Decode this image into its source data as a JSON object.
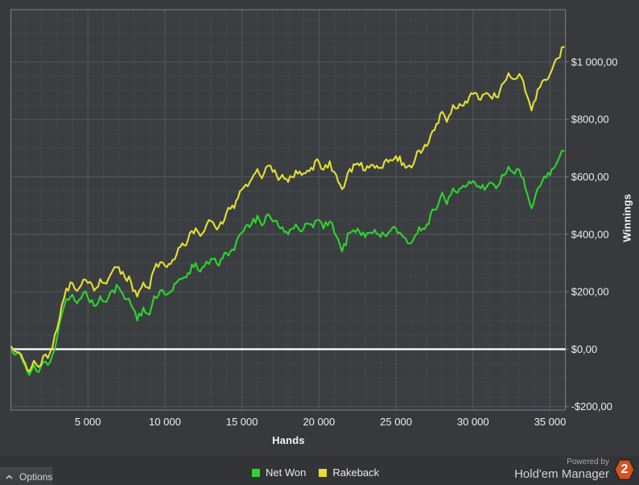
{
  "chart": {
    "x_axis": {
      "title": "Hands"
    },
    "y_axis": {
      "title": "Winnings"
    }
  },
  "chart_data": {
    "type": "line",
    "title": "",
    "xlabel": "Hands",
    "ylabel": "Winnings",
    "xlim": [
      0,
      36000
    ],
    "ylim": [
      -212,
      1182
    ],
    "x_ticks": [
      {
        "value": 5000,
        "label": "5 000"
      },
      {
        "value": 10000,
        "label": "10 000"
      },
      {
        "value": 15000,
        "label": "15 000"
      },
      {
        "value": 20000,
        "label": "20 000"
      },
      {
        "value": 25000,
        "label": "25 000"
      },
      {
        "value": 30000,
        "label": "30 000"
      },
      {
        "value": 35000,
        "label": "35 000"
      }
    ],
    "y_ticks": [
      {
        "value": 1000,
        "label": "$1 000,00"
      },
      {
        "value": 800,
        "label": "$800,00"
      },
      {
        "value": 600,
        "label": "$600,00"
      },
      {
        "value": 400,
        "label": "$400,00"
      },
      {
        "value": 200,
        "label": "$200,00"
      },
      {
        "value": 0,
        "label": "$0,00"
      },
      {
        "value": -200,
        "label": "-$200,00"
      }
    ],
    "grid": {
      "x_minor_step": 1000,
      "x_major_step": 5000,
      "y_minor_step": 50,
      "y_major_step": 200
    },
    "zero_line": true,
    "legend_position": "bottom",
    "series": [
      {
        "name": "Net Won",
        "color": "#2fd32f",
        "points": [
          [
            0,
            10
          ],
          [
            400,
            -15
          ],
          [
            800,
            -45
          ],
          [
            1200,
            -90
          ],
          [
            1500,
            -55
          ],
          [
            1800,
            -80
          ],
          [
            2100,
            -45
          ],
          [
            2400,
            -55
          ],
          [
            2700,
            -20
          ],
          [
            3000,
            40
          ],
          [
            3300,
            120
          ],
          [
            3600,
            175
          ],
          [
            4000,
            190
          ],
          [
            4300,
            160
          ],
          [
            4700,
            195
          ],
          [
            5000,
            180
          ],
          [
            5400,
            150
          ],
          [
            5800,
            185
          ],
          [
            6200,
            165
          ],
          [
            6600,
            205
          ],
          [
            7000,
            215
          ],
          [
            7400,
            175
          ],
          [
            7800,
            155
          ],
          [
            8200,
            100
          ],
          [
            8600,
            145
          ],
          [
            9000,
            120
          ],
          [
            9300,
            185
          ],
          [
            9700,
            205
          ],
          [
            10000,
            190
          ],
          [
            10500,
            205
          ],
          [
            11000,
            245
          ],
          [
            11500,
            265
          ],
          [
            12000,
            300
          ],
          [
            12300,
            270
          ],
          [
            12700,
            305
          ],
          [
            13000,
            315
          ],
          [
            13500,
            290
          ],
          [
            14000,
            335
          ],
          [
            14500,
            345
          ],
          [
            15000,
            405
          ],
          [
            15500,
            425
          ],
          [
            16000,
            465
          ],
          [
            16300,
            430
          ],
          [
            16700,
            470
          ],
          [
            17000,
            445
          ],
          [
            17500,
            420
          ],
          [
            18000,
            400
          ],
          [
            18500,
            435
          ],
          [
            19000,
            420
          ],
          [
            19500,
            435
          ],
          [
            20000,
            450
          ],
          [
            20300,
            420
          ],
          [
            20700,
            445
          ],
          [
            21000,
            405
          ],
          [
            21500,
            340
          ],
          [
            22000,
            405
          ],
          [
            22500,
            420
          ],
          [
            23000,
            390
          ],
          [
            23500,
            405
          ],
          [
            24000,
            390
          ],
          [
            24500,
            405
          ],
          [
            25000,
            420
          ],
          [
            25500,
            390
          ],
          [
            26000,
            370
          ],
          [
            26500,
            425
          ],
          [
            27000,
            435
          ],
          [
            27500,
            485
          ],
          [
            28000,
            545
          ],
          [
            28300,
            505
          ],
          [
            28700,
            560
          ],
          [
            29000,
            545
          ],
          [
            29500,
            565
          ],
          [
            30000,
            585
          ],
          [
            30500,
            560
          ],
          [
            31000,
            575
          ],
          [
            31500,
            560
          ],
          [
            32000,
            605
          ],
          [
            32300,
            635
          ],
          [
            32700,
            610
          ],
          [
            33000,
            625
          ],
          [
            33400,
            560
          ],
          [
            33800,
            490
          ],
          [
            34200,
            560
          ],
          [
            34500,
            585
          ],
          [
            35000,
            605
          ],
          [
            35500,
            655
          ],
          [
            35900,
            690
          ]
        ]
      },
      {
        "name": "Rakeback",
        "color": "#e6df32",
        "points": [
          [
            0,
            10
          ],
          [
            400,
            -10
          ],
          [
            800,
            -37
          ],
          [
            1200,
            -78
          ],
          [
            1500,
            -40
          ],
          [
            1800,
            -62
          ],
          [
            2100,
            -24
          ],
          [
            2400,
            -31
          ],
          [
            2700,
            7
          ],
          [
            3000,
            70
          ],
          [
            3300,
            153
          ],
          [
            3600,
            211
          ],
          [
            4000,
            230
          ],
          [
            4300,
            203
          ],
          [
            4700,
            242
          ],
          [
            5000,
            230
          ],
          [
            5400,
            204
          ],
          [
            5800,
            244
          ],
          [
            6200,
            228
          ],
          [
            6600,
            272
          ],
          [
            7000,
            286
          ],
          [
            7400,
            250
          ],
          [
            7800,
            234
          ],
          [
            8200,
            183
          ],
          [
            8600,
            232
          ],
          [
            9000,
            211
          ],
          [
            9300,
            279
          ],
          [
            9700,
            303
          ],
          [
            10000,
            291
          ],
          [
            10500,
            311
          ],
          [
            11000,
            356
          ],
          [
            11500,
            381
          ],
          [
            12000,
            421
          ],
          [
            12300,
            394
          ],
          [
            12700,
            433
          ],
          [
            13000,
            446
          ],
          [
            13500,
            426
          ],
          [
            14000,
            476
          ],
          [
            14500,
            491
          ],
          [
            15000,
            556
          ],
          [
            15500,
            581
          ],
          [
            16000,
            627
          ],
          [
            16300,
            595
          ],
          [
            16700,
            639
          ],
          [
            17000,
            617
          ],
          [
            17500,
            597
          ],
          [
            18000,
            582
          ],
          [
            18500,
            622
          ],
          [
            19000,
            612
          ],
          [
            19500,
            632
          ],
          [
            20000,
            652
          ],
          [
            20300,
            625
          ],
          [
            20700,
            654
          ],
          [
            21000,
            617
          ],
          [
            21500,
            557
          ],
          [
            22000,
            627
          ],
          [
            22500,
            647
          ],
          [
            23000,
            622
          ],
          [
            23500,
            642
          ],
          [
            24000,
            632
          ],
          [
            24500,
            652
          ],
          [
            25000,
            672
          ],
          [
            25500,
            647
          ],
          [
            26000,
            632
          ],
          [
            26500,
            692
          ],
          [
            27000,
            707
          ],
          [
            27500,
            762
          ],
          [
            28000,
            827
          ],
          [
            28300,
            791
          ],
          [
            28700,
            850
          ],
          [
            29000,
            838
          ],
          [
            29500,
            863
          ],
          [
            30000,
            888
          ],
          [
            30500,
            868
          ],
          [
            31000,
            888
          ],
          [
            31500,
            878
          ],
          [
            32000,
            928
          ],
          [
            32300,
            961
          ],
          [
            32700,
            940
          ],
          [
            33000,
            958
          ],
          [
            33400,
            897
          ],
          [
            33800,
            831
          ],
          [
            34200,
            905
          ],
          [
            34500,
            933
          ],
          [
            35000,
            958
          ],
          [
            35500,
            1013
          ],
          [
            35900,
            1052
          ]
        ]
      }
    ],
    "render": {
      "noise_amp": 15,
      "noise_seed": 7,
      "step_hands": 130
    }
  },
  "colors": {
    "outer_bg": "#37393c",
    "plot_bg": "#3b3e41",
    "grid_minor": "#434649",
    "grid_major": "#55585b",
    "plot_border": "#73777b",
    "zero_line": "#fafafa",
    "tick_text": "#eceef0"
  },
  "options_bar": {
    "label": "Options"
  },
  "branding": {
    "powered_by": "Powered by",
    "product": "Hold'em Manager",
    "badge": "2",
    "badge_color": "#d4541d"
  }
}
